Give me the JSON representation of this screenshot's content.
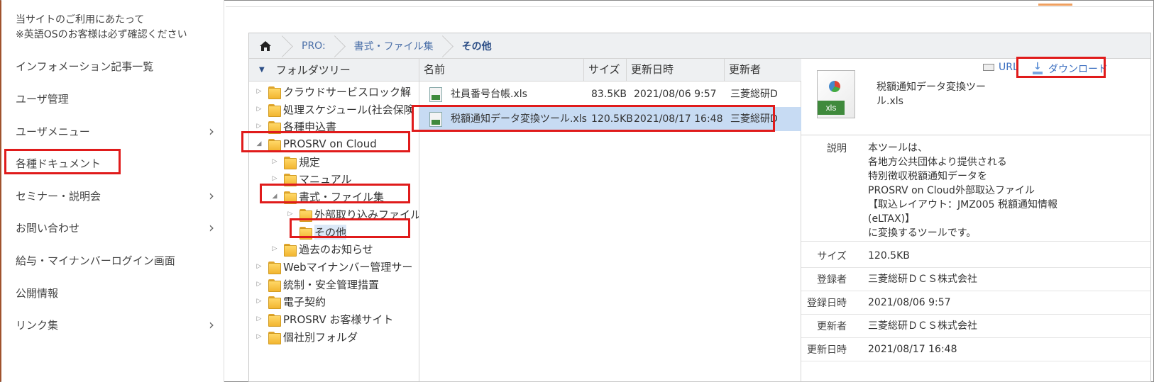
{
  "left_menu": {
    "notice_line1": "当サイトのご利用にあたって",
    "notice_line2": "※英語OSのお客様は必ず確認ください",
    "items": [
      {
        "label": "インフォメーション記事一覧"
      },
      {
        "label": "ユーザ管理"
      },
      {
        "label": "ユーザメニュー",
        "chevron": "›"
      },
      {
        "label": "各種ドキュメント"
      },
      {
        "label": "セミナー・説明会",
        "chevron": "›"
      },
      {
        "label": "お問い合わせ",
        "chevron": "›"
      },
      {
        "label": "給与・マイナンバーログイン画面"
      },
      {
        "label": "公開情報"
      },
      {
        "label": "リンク集",
        "chevron": "›"
      }
    ]
  },
  "breadcrumb": {
    "home_icon": "home-icon",
    "items": [
      "PRO:",
      "書式・ファイル集",
      "その他"
    ]
  },
  "tree": {
    "header": "フォルダツリー",
    "nodes": [
      {
        "label": "クラウドサービスロック解",
        "exp": "▷"
      },
      {
        "label": "処理スケジュール(社会保険",
        "exp": "▷"
      },
      {
        "label": "各種申込書",
        "exp": "▷"
      },
      {
        "label": "PROSRV on Cloud",
        "exp": "◢"
      },
      {
        "label": "規定",
        "exp": "▷"
      },
      {
        "label": "マニュアル",
        "exp": "▷"
      },
      {
        "label": "書式・ファイル集",
        "exp": "◢"
      },
      {
        "label": "外部取り込みファイル",
        "exp": "▷"
      },
      {
        "label": "その他",
        "exp": ""
      },
      {
        "label": "過去のお知らせ",
        "exp": "▷"
      },
      {
        "label": "Webマイナンバー管理サー",
        "exp": "▷"
      },
      {
        "label": "統制・安全管理措置",
        "exp": "▷"
      },
      {
        "label": "電子契約",
        "exp": "▷"
      },
      {
        "label": "PROSRV お客様サイト",
        "exp": "▷"
      },
      {
        "label": "個社別フォルダ",
        "exp": "▷"
      }
    ]
  },
  "files": {
    "columns": {
      "name": "名前",
      "size": "サイズ",
      "updated": "更新日時",
      "updater": "更新者"
    },
    "rows": [
      {
        "name": "社員番号台帳.xls",
        "size": "83.5KB",
        "updated": "2021/08/06 9:57",
        "updater": "三菱総研D"
      },
      {
        "name": "税額通知データ変換ツール.xls",
        "size": "120.5KB",
        "updated": "2021/08/17 16:48",
        "updater": "三菱総研D"
      }
    ]
  },
  "details": {
    "file_name": "税額通知データ変換ツール.xls",
    "url_label": "URL",
    "download_label": "ダウンロード",
    "icon_badge": "xls",
    "fields": [
      {
        "key": "説明",
        "value": "本ツールは、\n各地方公共団体より提供される\n特別徴収税額通知データを\nPROSRV on Cloud外部取込ファイル\n【取込レイアウト：JMZ005 税額通知情報(eLTAX)】\nに変換するツールです。"
      },
      {
        "key": "サイズ",
        "value": "120.5KB"
      },
      {
        "key": "登録者",
        "value": "三菱総研ＤＣＳ株式会社"
      },
      {
        "key": "登録日時",
        "value": "2021/08/06 9:57"
      },
      {
        "key": "更新者",
        "value": "三菱総研ＤＣＳ株式会社"
      },
      {
        "key": "更新日時",
        "value": "2021/08/17 16:48"
      }
    ]
  },
  "colors": {
    "highlight": "#e01b1b",
    "link": "#3c6fc0",
    "selection": "#c7dbf3"
  }
}
